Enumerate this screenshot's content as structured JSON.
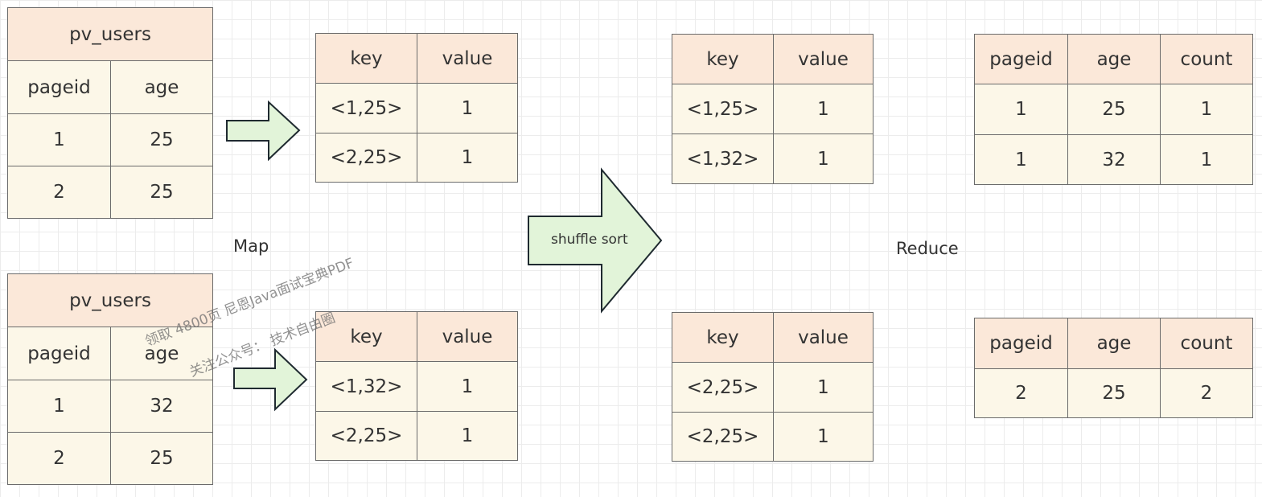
{
  "labels": {
    "map": "Map",
    "reduce": "Reduce",
    "shuffle": "shuffle sort"
  },
  "watermark": {
    "line1": "领取 4800页 尼恩Java面试宝典PDF",
    "line2": "关注公众号：  技术自由圈"
  },
  "colors": {
    "header": "#fbe8d9",
    "body": "#fcf7e8",
    "arrow_fill": "#e2f4d9",
    "border": "#6b6b6b"
  },
  "tables": [
    {
      "id": "input-1",
      "title": "pv_users",
      "headers": [
        "pageid",
        "age"
      ],
      "rows": [
        [
          "1",
          "25"
        ],
        [
          "2",
          "25"
        ]
      ]
    },
    {
      "id": "input-2",
      "title": "pv_users",
      "headers": [
        "pageid",
        "age"
      ],
      "rows": [
        [
          "1",
          "32"
        ],
        [
          "2",
          "25"
        ]
      ]
    },
    {
      "id": "map-out-1",
      "headers": [
        "key",
        "value"
      ],
      "rows": [
        [
          "<1,25>",
          "1"
        ],
        [
          "<2,25>",
          "1"
        ]
      ]
    },
    {
      "id": "map-out-2",
      "headers": [
        "key",
        "value"
      ],
      "rows": [
        [
          "<1,32>",
          "1"
        ],
        [
          "<2,25>",
          "1"
        ]
      ]
    },
    {
      "id": "shuffle-out-1",
      "headers": [
        "key",
        "value"
      ],
      "rows": [
        [
          "<1,25>",
          "1"
        ],
        [
          "<1,32>",
          "1"
        ]
      ]
    },
    {
      "id": "shuffle-out-2",
      "headers": [
        "key",
        "value"
      ],
      "rows": [
        [
          "<2,25>",
          "1"
        ],
        [
          "<2,25>",
          "1"
        ]
      ]
    },
    {
      "id": "reduce-out-1",
      "headers": [
        "pageid",
        "age",
        "count"
      ],
      "rows": [
        [
          "1",
          "25",
          "1"
        ],
        [
          "1",
          "32",
          "1"
        ]
      ]
    },
    {
      "id": "reduce-out-2",
      "headers": [
        "pageid",
        "age",
        "count"
      ],
      "rows": [
        [
          "2",
          "25",
          "2"
        ]
      ]
    }
  ]
}
